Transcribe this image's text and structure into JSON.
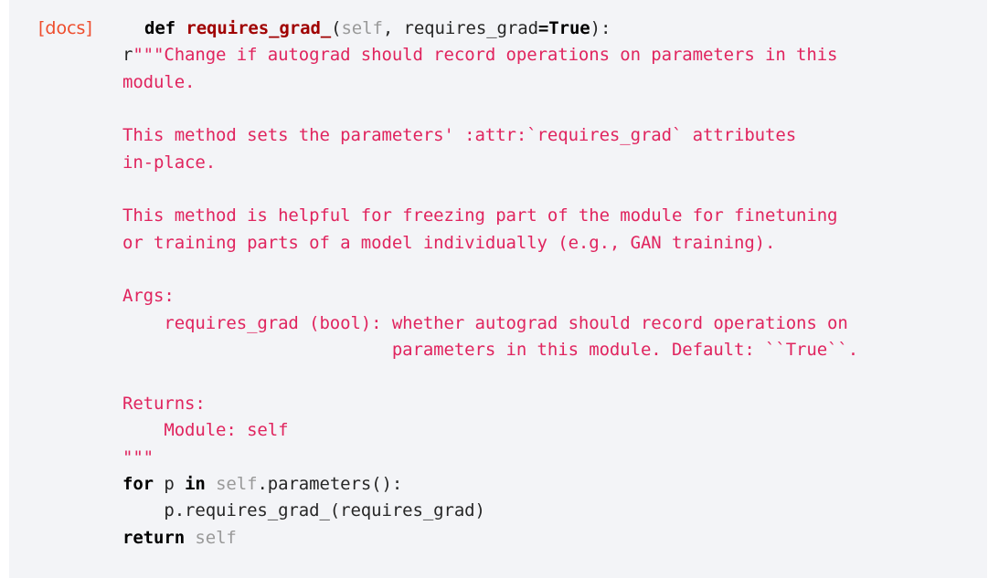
{
  "docs_link": {
    "label": "[docs]",
    "color": "#ee4c2c"
  },
  "code": {
    "def_keyword": "def",
    "function_name": "requires_grad_",
    "signature": {
      "open_paren": "(",
      "self_param": "self",
      "sep": ", requires_grad",
      "eq": "=",
      "default": "True",
      "close": "):"
    },
    "docstring_prefix": "r",
    "docstring_lines": [
      "\"\"\"Change if autograd should record operations on parameters in this",
      "module.",
      "",
      "This method sets the parameters' :attr:`requires_grad` attributes",
      "in-place.",
      "",
      "This method is helpful for freezing part of the module for finetuning",
      "or training parts of a model individually (e.g., GAN training).",
      "",
      "Args:",
      "    requires_grad (bool): whether autograd should record operations on",
      "                          parameters in this module. Default: ``True``.",
      "",
      "Returns:",
      "    Module: self",
      "\"\"\""
    ],
    "for_line": {
      "for_kw": "for",
      "var": " p ",
      "in_kw": "in",
      "self_kw": "self",
      "rest": ".parameters():"
    },
    "body_line": "    p.requires_grad_(requires_grad)",
    "return_line": {
      "return_kw": "return",
      "self_kw": "self"
    }
  },
  "colors": {
    "background": "#f3f4f7",
    "docstring": "#e0245e",
    "function_name": "#a00000",
    "self": "#999999"
  }
}
